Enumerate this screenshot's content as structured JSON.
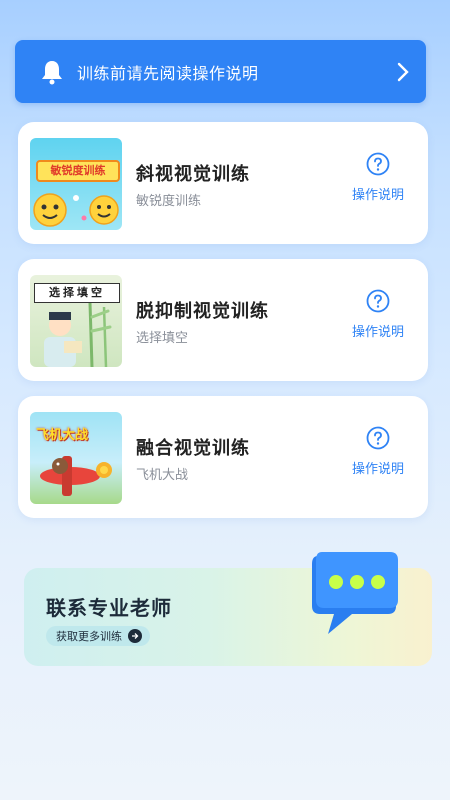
{
  "notice": {
    "text": "训练前请先阅读操作说明",
    "icon": "bell-icon"
  },
  "cards": [
    {
      "thumb_text": "敏锐度训练",
      "title": "斜视视觉训练",
      "subtitle": "敏锐度训练",
      "help_label": "操作说明"
    },
    {
      "thumb_text": "选择填空",
      "title": "脱抑制视觉训练",
      "subtitle": "选择填空",
      "help_label": "操作说明"
    },
    {
      "thumb_text": "飞机大战",
      "title": "融合视觉训练",
      "subtitle": "飞机大战",
      "help_label": "操作说明"
    }
  ],
  "contact": {
    "title": "联系专业老师",
    "button_label": "获取更多训练"
  },
  "colors": {
    "accent": "#2f83f5",
    "title": "#222222",
    "subtitle": "#8a8f99"
  }
}
